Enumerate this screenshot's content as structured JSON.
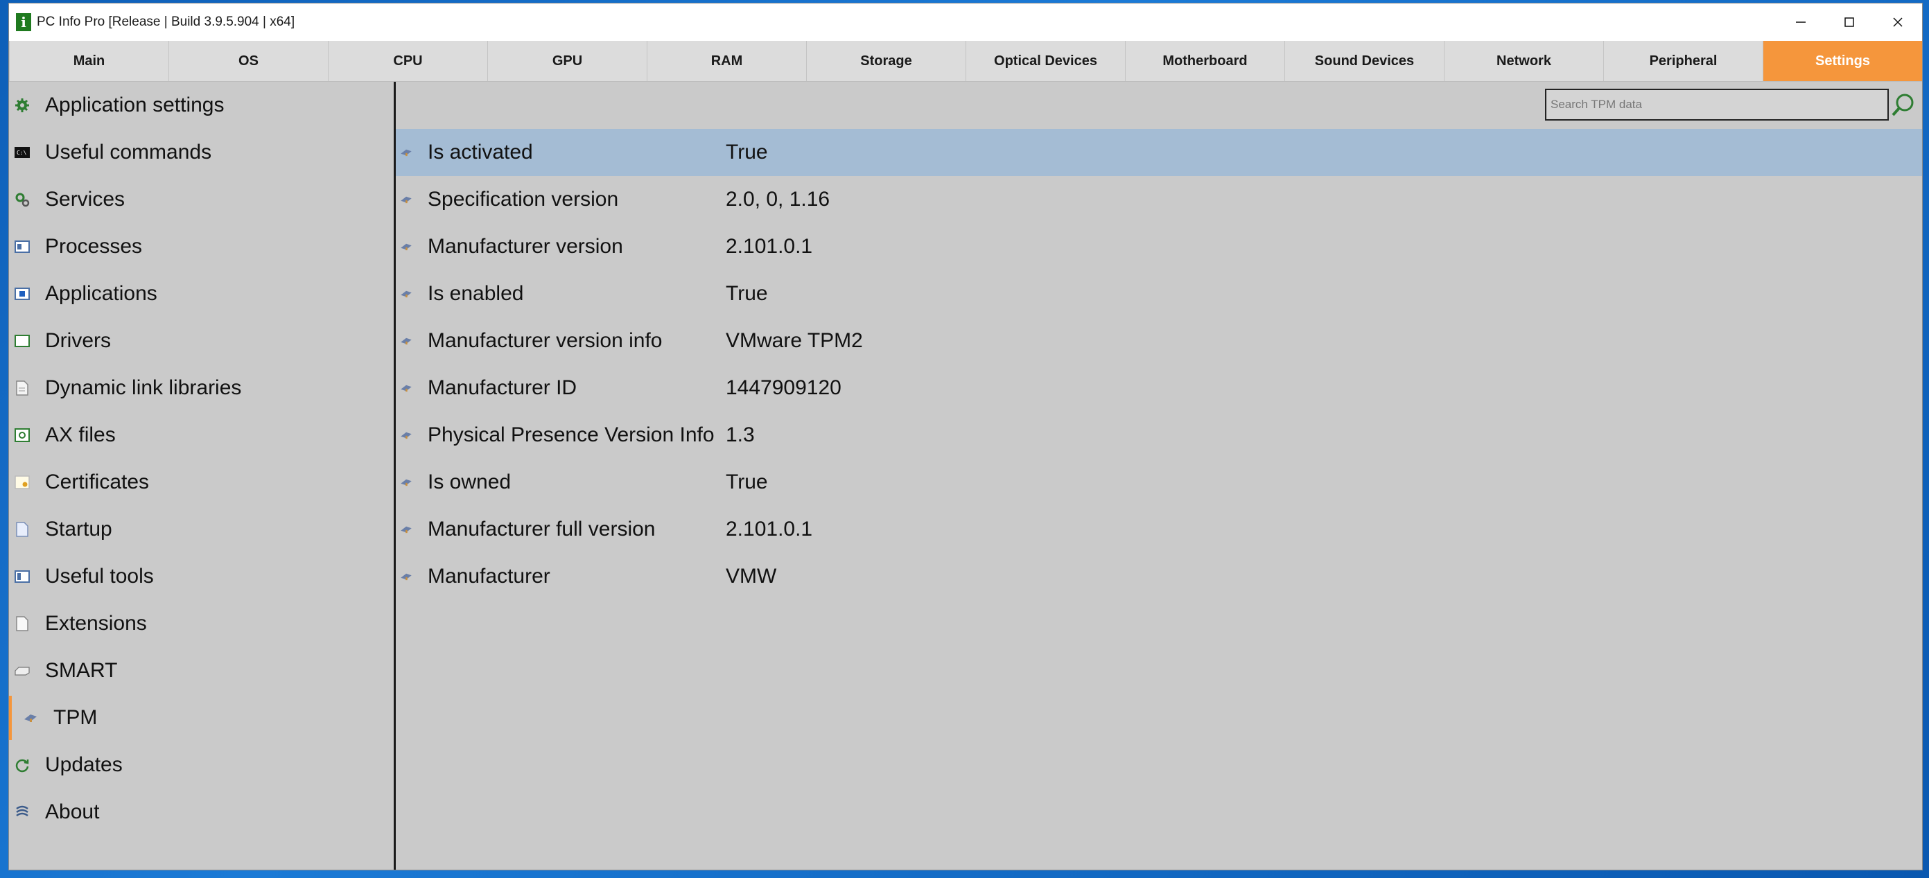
{
  "window": {
    "title": "PC Info Pro [Release | Build 3.9.5.904 | x64]",
    "app_icon_letter": "i",
    "controls": {
      "minimize": "—",
      "maximize": "☐",
      "close": "✕"
    }
  },
  "tabs": [
    {
      "label": "Main"
    },
    {
      "label": "OS"
    },
    {
      "label": "CPU"
    },
    {
      "label": "GPU"
    },
    {
      "label": "RAM"
    },
    {
      "label": "Storage"
    },
    {
      "label": "Optical Devices"
    },
    {
      "label": "Motherboard"
    },
    {
      "label": "Sound Devices"
    },
    {
      "label": "Network"
    },
    {
      "label": "Peripheral"
    },
    {
      "label": "Settings",
      "active": true
    }
  ],
  "sidebar": {
    "items": [
      {
        "label": "Application settings",
        "icon": "gear-icon"
      },
      {
        "label": "Useful commands",
        "icon": "terminal-icon"
      },
      {
        "label": "Services",
        "icon": "services-gears-icon"
      },
      {
        "label": "Processes",
        "icon": "processes-window-icon"
      },
      {
        "label": "Applications",
        "icon": "applications-icon"
      },
      {
        "label": "Drivers",
        "icon": "drivers-icon"
      },
      {
        "label": "Dynamic link libraries",
        "icon": "dll-file-icon"
      },
      {
        "label": "AX files",
        "icon": "ax-file-icon"
      },
      {
        "label": "Certificates",
        "icon": "certificate-icon"
      },
      {
        "label": "Startup",
        "icon": "startup-icon"
      },
      {
        "label": "Useful tools",
        "icon": "tools-icon"
      },
      {
        "label": "Extensions",
        "icon": "extension-file-icon"
      },
      {
        "label": "SMART",
        "icon": "disk-icon"
      },
      {
        "label": "TPM",
        "icon": "tpm-chip-icon",
        "active": true
      },
      {
        "label": "Updates",
        "icon": "refresh-icon"
      },
      {
        "label": "About",
        "icon": "about-icon"
      }
    ]
  },
  "search": {
    "placeholder": "Search TPM data",
    "value": ""
  },
  "tpm_rows": [
    {
      "key": "Is activated",
      "value": "True",
      "selected": true
    },
    {
      "key": "Specification version",
      "value": "2.0, 0, 1.16"
    },
    {
      "key": "Manufacturer version",
      "value": "2.101.0.1"
    },
    {
      "key": "Is enabled",
      "value": "True"
    },
    {
      "key": "Manufacturer version info",
      "value": "VMware TPM2"
    },
    {
      "key": "Manufacturer ID",
      "value": "1447909120"
    },
    {
      "key": "Physical Presence Version Info",
      "value": "1.3"
    },
    {
      "key": "Is owned",
      "value": "True"
    },
    {
      "key": "Manufacturer full version",
      "value": "2.101.0.1"
    },
    {
      "key": "Manufacturer",
      "value": "VMW"
    }
  ],
  "colors": {
    "accent": "#f5963c",
    "selected_row": "#a4bcd4",
    "background": "#cacaca"
  }
}
